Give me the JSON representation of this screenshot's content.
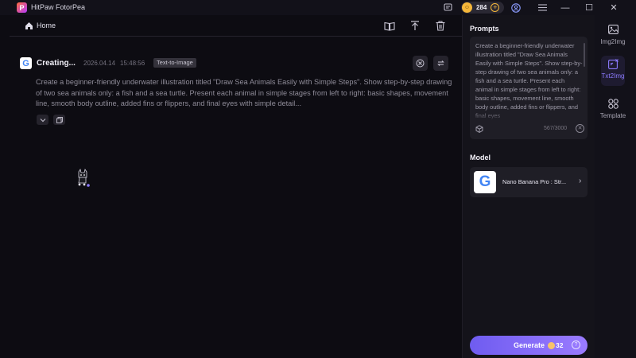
{
  "app": {
    "title": "HitPaw FotorPea",
    "logo_letter": "P"
  },
  "titlebar": {
    "credits": "284",
    "coin_symbol": "☺",
    "coin_plus": "+",
    "minimize": "—",
    "maximize": "☐",
    "close": "✕"
  },
  "header": {
    "home_label": "Home"
  },
  "task": {
    "title": "Creating...",
    "date": "2026.04.14",
    "time": "15:48:56",
    "badge": "Text-to-Image",
    "prompt": "Create a beginner-friendly underwater illustration titled \"Draw Sea Animals Easily with Simple Steps\". Show step-by-step drawing of two sea animals only: a fish and a sea turtle. Present each animal in simple stages from left to right: basic shapes, movement line, smooth body outline, added fins or flippers, and final eyes with simple detail..."
  },
  "panel": {
    "prompts_heading": "Prompts",
    "prompt_text": "Create a beginner-friendly underwater illustration titled \"Draw Sea Animals Easily with Simple Steps\". Show step-by-step drawing of two sea animals only: a fish and a sea turtle. Present each animal in simple stages from left to right: basic shapes, movement line, smooth body outline, added fins or flippers, and final eyes",
    "char_count": "567/3000",
    "model_heading": "Model",
    "model_name": "Nano Banana Pro : Str...",
    "model_logo_letter": "G",
    "generate_label": "Generate",
    "generate_cost": "32"
  },
  "sidenav": {
    "items": [
      {
        "label": "Img2Img",
        "icon": "image-icon"
      },
      {
        "label": "Txt2Img",
        "icon": "text-image-icon",
        "active": true
      },
      {
        "label": "Template",
        "icon": "grid-icon"
      }
    ]
  },
  "colors": {
    "accent": "#8c7bff",
    "generate_start": "#6f5cf0",
    "generate_end": "#9a7bff",
    "coin": "#f5b73a",
    "background": "#0d0c12"
  }
}
